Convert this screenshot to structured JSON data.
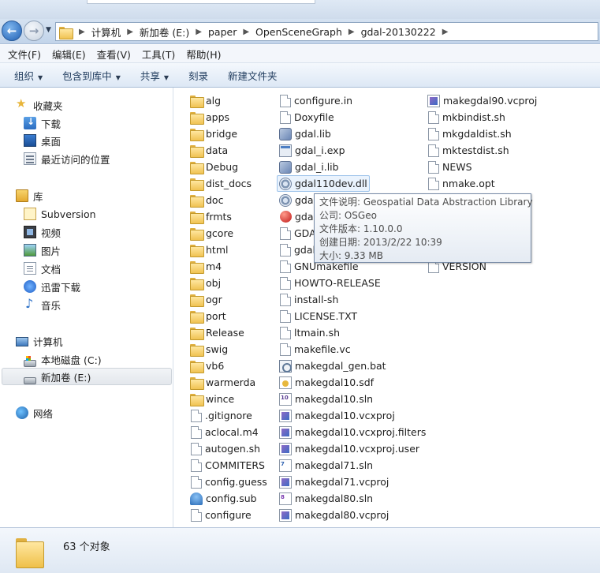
{
  "address": {
    "crumbs": [
      "计算机",
      "新加卷 (E:)",
      "paper",
      "OpenSceneGraph",
      "gdal-20130222"
    ]
  },
  "menu": [
    "文件(F)",
    "编辑(E)",
    "查看(V)",
    "工具(T)",
    "帮助(H)"
  ],
  "toolbar": {
    "organize": "组织",
    "include_library": "包含到库中",
    "share": "共享",
    "burn": "刻录",
    "new_folder": "新建文件夹"
  },
  "sidebar": {
    "favorites": "收藏夹",
    "downloads": "下载",
    "desktop": "桌面",
    "recent": "最近访问的位置",
    "libraries": "库",
    "subversion": "Subversion",
    "videos": "视频",
    "pictures": "图片",
    "documents": "文档",
    "xunlei": "迅雷下载",
    "music": "音乐",
    "computer": "计算机",
    "drive_c": "本地磁盘 (C:)",
    "drive_e": "新加卷 (E:)",
    "network": "网络"
  },
  "files": {
    "col1": [
      "alg",
      "apps",
      "bridge",
      "data",
      "Debug",
      "dist_docs",
      "doc",
      "frmts",
      "gcore",
      "html",
      "m4",
      "obj",
      "ogr",
      "port",
      "Release",
      "swig",
      "vb6",
      "warmerda",
      "wince",
      ".gitignore",
      "aclocal.m4",
      "autogen.sh",
      "COMMITERS",
      "config.guess",
      "config.sub",
      "configure"
    ],
    "col2": [
      "configure.in",
      "Doxyfile",
      "gdal.lib",
      "gdal_i.exp",
      "gdal_i.lib",
      "gdal110dev.dll",
      "gdal",
      "gdal",
      "GDAL",
      "gdal",
      "GNUmakefile",
      "HOWTO-RELEASE",
      "install-sh",
      "LICENSE.TXT",
      "ltmain.sh",
      "makefile.vc",
      "makegdal_gen.bat",
      "makegdal10.sdf",
      "makegdal10.sln",
      "makegdal10.vcxproj",
      "makegdal10.vcxproj.filters",
      "makegdal10.vcxproj.user",
      "makegdal71.sln",
      "makegdal71.vcproj",
      "makegdal80.sln",
      "makegdal80.vcproj"
    ],
    "col3": [
      "makegdal90.vcproj",
      "mkbindist.sh",
      "mkgdaldist.sh",
      "mktestdist.sh",
      "NEWS",
      "nmake.opt",
      "",
      "",
      "",
      "",
      "VERSION"
    ]
  },
  "tooltip": {
    "line1": "文件说明: Geospatial Data Abstraction Library",
    "line2": "公司: OSGeo",
    "line3": "文件版本: 1.10.0.0",
    "line4": "创建日期: 2013/2/22 10:39",
    "line5": "大小: 9.33 MB"
  },
  "status": {
    "count": "63 个对象"
  }
}
